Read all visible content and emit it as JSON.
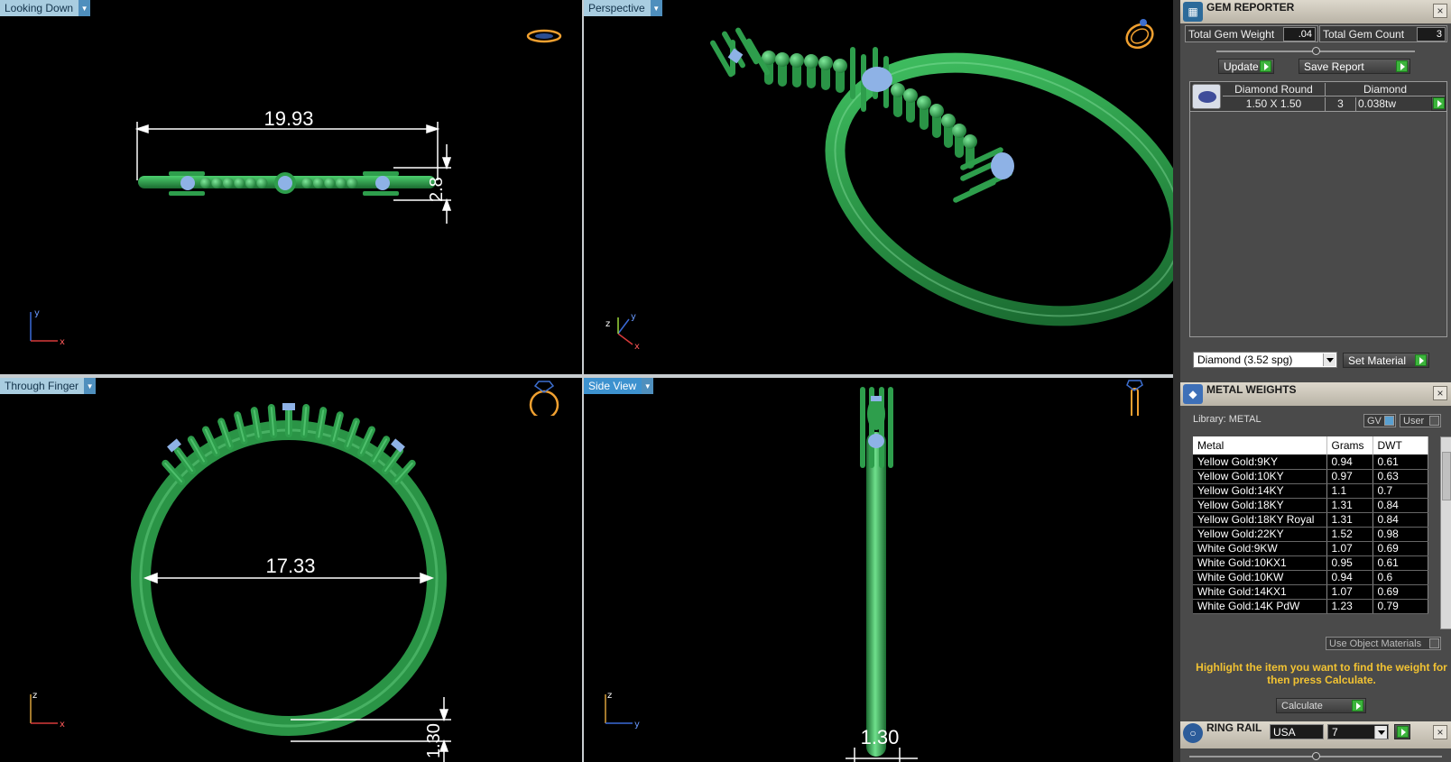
{
  "viewports": {
    "top_left": {
      "label": "Looking Down",
      "dimensions": [
        "19.93",
        "2.8"
      ]
    },
    "top_right": {
      "label": "Perspective"
    },
    "bottom_left": {
      "label": "Through Finger",
      "dimensions": [
        "17.33",
        "1.30"
      ]
    },
    "bottom_right": {
      "label": "Side View",
      "dimensions": [
        "1.30"
      ]
    }
  },
  "axis_labels": {
    "x": "x",
    "y": "y",
    "z": "z"
  },
  "gem_reporter": {
    "title": "GEM REPORTER",
    "total_weight_label": "Total Gem Weight",
    "total_weight_value": ".04",
    "total_count_label": "Total Gem Count",
    "total_count_value": "3",
    "update_label": "Update",
    "save_report_label": "Save Report",
    "row": {
      "name": "Diamond Round",
      "size": "1.50 X 1.50",
      "material": "Diamond",
      "count": "3",
      "weight": "0.038tw"
    },
    "material_select": "Diamond   (3.52 spg)",
    "set_material_label": "Set Material"
  },
  "metal_weights": {
    "title": "METAL WEIGHTS",
    "library_label": "Library: METAL",
    "gv_label": "GV",
    "user_label": "User",
    "columns": [
      "Metal",
      "Grams",
      "DWT"
    ],
    "rows": [
      [
        "Yellow Gold:9KY",
        "0.94",
        "0.61"
      ],
      [
        "Yellow Gold:10KY",
        "0.97",
        "0.63"
      ],
      [
        "Yellow Gold:14KY",
        "1.1",
        "0.7"
      ],
      [
        "Yellow Gold:18KY",
        "1.31",
        "0.84"
      ],
      [
        "Yellow Gold:18KY Royal",
        "1.31",
        "0.84"
      ],
      [
        "Yellow Gold:22KY",
        "1.52",
        "0.98"
      ],
      [
        "White Gold:9KW",
        "1.07",
        "0.69"
      ],
      [
        "White Gold:10KX1",
        "0.95",
        "0.61"
      ],
      [
        "White Gold:10KW",
        "0.94",
        "0.6"
      ],
      [
        "White Gold:14KX1",
        "1.07",
        "0.69"
      ],
      [
        "White Gold:14K PdW",
        "1.23",
        "0.79"
      ]
    ],
    "use_object_materials_label": "Use Object Materials",
    "hint": "Highlight the item you want to find the weight for then press Calculate.",
    "calculate_label": "Calculate"
  },
  "ring_rail": {
    "title": "RING RAIL",
    "country": "USA",
    "size": "7"
  },
  "colors": {
    "ring": "#2e9e4c",
    "ring_dark": "#1d6e34",
    "gem": "#8eb2e6",
    "dim": "#ffffff",
    "accent": "#f0a030"
  }
}
